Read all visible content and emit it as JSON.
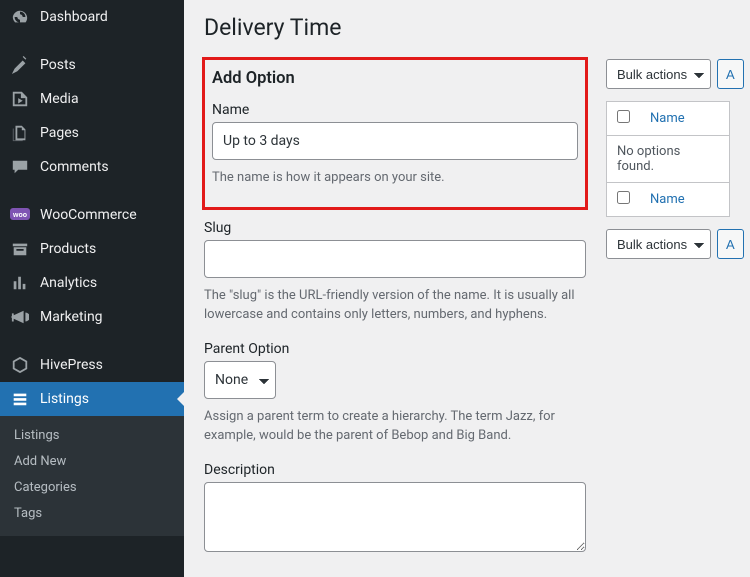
{
  "sidebar": {
    "items": [
      {
        "label": "Dashboard",
        "icon": "dashboard"
      },
      {
        "label": "Posts",
        "icon": "pin"
      },
      {
        "label": "Media",
        "icon": "media"
      },
      {
        "label": "Pages",
        "icon": "pages"
      },
      {
        "label": "Comments",
        "icon": "comments"
      },
      {
        "label": "WooCommerce",
        "icon": "woo"
      },
      {
        "label": "Products",
        "icon": "products"
      },
      {
        "label": "Analytics",
        "icon": "analytics"
      },
      {
        "label": "Marketing",
        "icon": "marketing"
      },
      {
        "label": "HivePress",
        "icon": "hivepress"
      },
      {
        "label": "Listings",
        "icon": "listings"
      }
    ],
    "submenu": [
      {
        "label": "Listings"
      },
      {
        "label": "Add New"
      },
      {
        "label": "Categories"
      },
      {
        "label": "Tags"
      }
    ]
  },
  "page": {
    "title": "Delivery Time"
  },
  "form": {
    "heading": "Add Option",
    "name": {
      "label": "Name",
      "value": "Up to 3 days",
      "help": "The name is how it appears on your site."
    },
    "slug": {
      "label": "Slug",
      "value": "",
      "help": "The \"slug\" is the URL-friendly version of the name. It is usually all lowercase and contains only letters, numbers, and hyphens."
    },
    "parent": {
      "label": "Parent Option",
      "selected": "None",
      "help": "Assign a parent term to create a hierarchy. The term Jazz, for example, would be the parent of Bebop and Big Band."
    },
    "description": {
      "label": "Description",
      "value": ""
    }
  },
  "list": {
    "bulk_label_top": "Bulk actions",
    "bulk_label_bottom": "Bulk actions",
    "apply_label": "A",
    "col_name": "Name",
    "empty_text": "No options found."
  }
}
